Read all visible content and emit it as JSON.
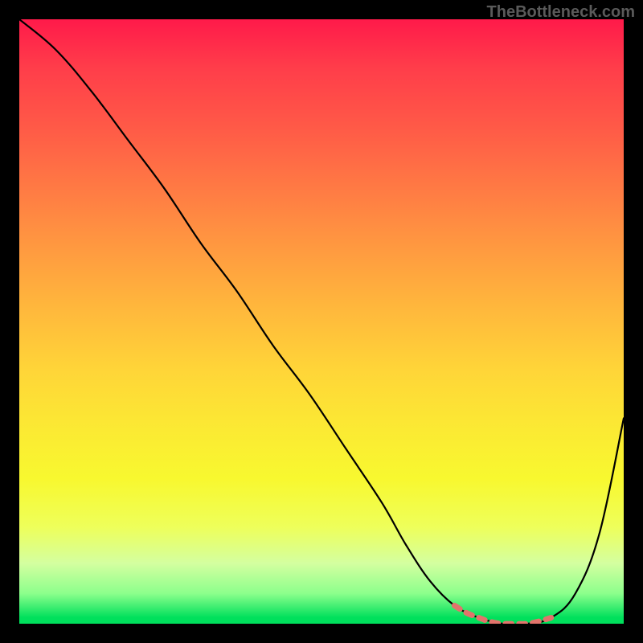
{
  "watermark": "TheBottleneck.com",
  "chart_data": {
    "type": "line",
    "title": "",
    "xlabel": "",
    "ylabel": "",
    "xlim": [
      0,
      100
    ],
    "ylim": [
      0,
      100
    ],
    "grid": false,
    "series": [
      {
        "name": "main-curve",
        "color": "#000000",
        "x": [
          0,
          6,
          12,
          18,
          24,
          30,
          36,
          42,
          48,
          54,
          60,
          64,
          68,
          72,
          76,
          80,
          84,
          88,
          92,
          96,
          100
        ],
        "values": [
          100,
          95,
          88,
          80,
          72,
          63,
          55,
          46,
          38,
          29,
          20,
          13,
          7,
          3,
          1,
          0,
          0,
          1,
          5,
          15,
          34
        ]
      },
      {
        "name": "highlight-segment",
        "color": "#e2736b",
        "x": [
          72,
          74,
          76,
          78,
          80,
          82,
          84,
          86,
          88
        ],
        "values": [
          3,
          1.8,
          1,
          0.3,
          0,
          0,
          0,
          0.4,
          1
        ]
      }
    ],
    "gradient_stops": [
      {
        "pos": 0,
        "color": "#ff1a4a"
      },
      {
        "pos": 50,
        "color": "#ffc63a"
      },
      {
        "pos": 80,
        "color": "#f8f82f"
      },
      {
        "pos": 99,
        "color": "#00e05c"
      }
    ]
  }
}
